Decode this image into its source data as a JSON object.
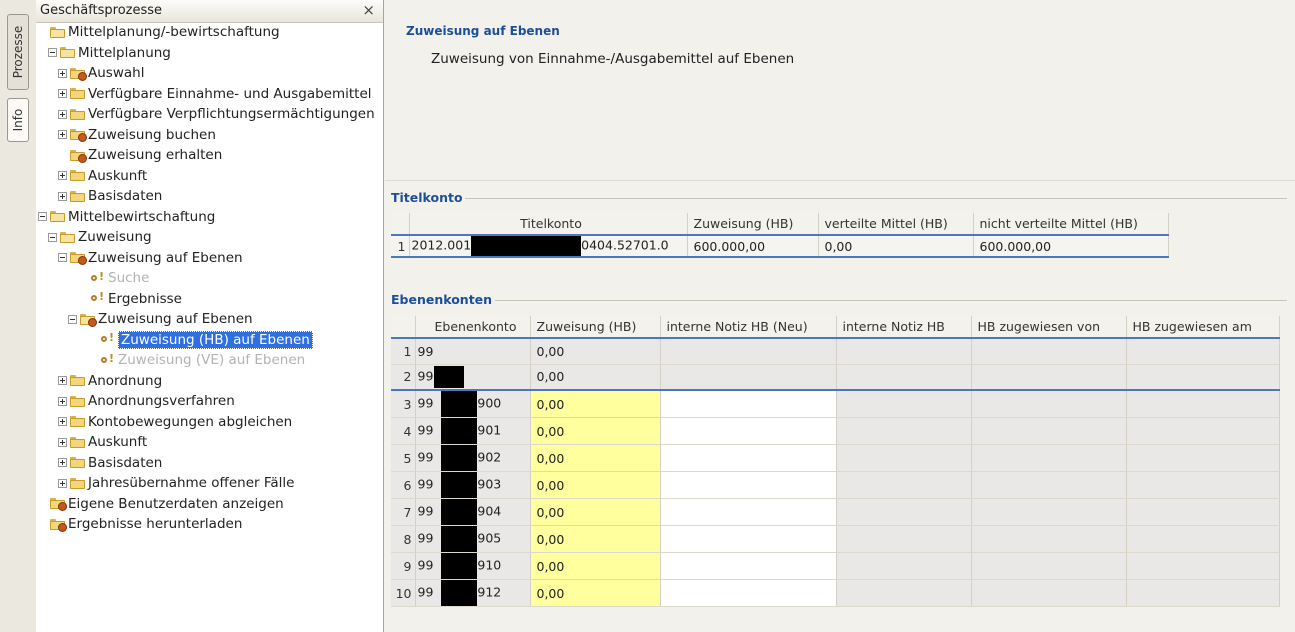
{
  "side_tabs": [
    "Prozesse",
    "Info"
  ],
  "tree_panel": {
    "title": "Geschäftsprozesse",
    "close": "×",
    "nodes": [
      {
        "label": "Mittelplanung/-bewirtschaftung",
        "icon": "folder-open-icon",
        "expander": "none"
      },
      {
        "label": "Mittelplanung",
        "icon": "folder-open-icon",
        "expander": "minus"
      },
      {
        "label": "Auswahl",
        "icon": "process-folder-icon",
        "expander": "plus"
      },
      {
        "label": "Verfügbare Einnahme- und Ausgabemittel",
        "icon": "folder-icon",
        "expander": "plus"
      },
      {
        "label": "Verfügbare Verpflichtungsermächtigungen",
        "icon": "folder-icon",
        "expander": "plus"
      },
      {
        "label": "Zuweisung buchen",
        "icon": "process-folder-icon",
        "expander": "plus"
      },
      {
        "label": "Zuweisung erhalten",
        "icon": "process-folder-icon",
        "expander": "none"
      },
      {
        "label": "Auskunft",
        "icon": "folder-icon",
        "expander": "plus"
      },
      {
        "label": "Basisdaten",
        "icon": "folder-icon",
        "expander": "plus"
      },
      {
        "label": "Mittelbewirtschaftung",
        "icon": "folder-open-icon",
        "expander": "minus"
      },
      {
        "label": "Zuweisung",
        "icon": "folder-open-icon",
        "expander": "minus"
      },
      {
        "label": "Zuweisung auf Ebenen",
        "icon": "process-folder-icon",
        "expander": "minus"
      },
      {
        "label": "Suche",
        "icon": "key-icon",
        "expander": "none",
        "state": "disabled"
      },
      {
        "label": "Ergebnisse",
        "icon": "key-icon",
        "expander": "none"
      },
      {
        "label": "Zuweisung auf Ebenen",
        "icon": "process-folder-open-icon",
        "expander": "minus"
      },
      {
        "label": "Zuweisung (HB) auf Ebenen",
        "icon": "key-icon",
        "expander": "none",
        "state": "selected"
      },
      {
        "label": "Zuweisung (VE) auf Ebenen",
        "icon": "key-icon",
        "expander": "none",
        "state": "disabled"
      },
      {
        "label": "Anordnung",
        "icon": "folder-icon",
        "expander": "plus"
      },
      {
        "label": "Anordnungsverfahren",
        "icon": "folder-icon",
        "expander": "plus"
      },
      {
        "label": "Kontobewegungen abgleichen",
        "icon": "folder-icon",
        "expander": "plus"
      },
      {
        "label": "Auskunft",
        "icon": "folder-icon",
        "expander": "plus"
      },
      {
        "label": "Basisdaten",
        "icon": "folder-icon",
        "expander": "plus"
      },
      {
        "label": "Jahresübernahme offener Fälle",
        "icon": "folder-icon",
        "expander": "plus"
      },
      {
        "label": "Eigene Benutzerdaten anzeigen",
        "icon": "process-folder-icon",
        "expander": "none"
      },
      {
        "label": "Ergebnisse herunterladen",
        "icon": "process-folder-icon",
        "expander": "none"
      }
    ]
  },
  "content": {
    "title": "Zuweisung auf Ebenen",
    "description": "Zuweisung von Einnahme-/Ausgabemittel auf Ebenen",
    "titelkonto": {
      "section_label": "Titelkonto",
      "columns": [
        "Titelkonto",
        "Zuweisung (HB)",
        "verteilte Mittel (HB)",
        "nicht verteilte Mittel (HB)"
      ],
      "rows": [
        {
          "num": "1",
          "konto_prefix": "2012.001",
          "konto_suffix": "0404.52701.0",
          "zuweisung": "600.000,00",
          "verteilt": "0,00",
          "nicht_verteilt": "600.000,00"
        }
      ]
    },
    "ebenenkonten": {
      "section_label": "Ebenenkonten",
      "columns": [
        "Ebenenkonto",
        "Zuweisung (HB)",
        "interne Notiz HB (Neu)",
        "interne Notiz HB",
        "HB zugewiesen von",
        "HB zugewiesen am"
      ],
      "rows": [
        {
          "num": "1",
          "prefix": "99",
          "suffix": "",
          "zuweisung": "0,00"
        },
        {
          "num": "2",
          "prefix": "99",
          "suffix": "",
          "zuweisung": "0,00"
        },
        {
          "num": "3",
          "prefix": "99",
          "suffix": "900",
          "zuweisung": "0,00"
        },
        {
          "num": "4",
          "prefix": "99",
          "suffix": "901",
          "zuweisung": "0,00"
        },
        {
          "num": "5",
          "prefix": "99",
          "suffix": "902",
          "zuweisung": "0,00"
        },
        {
          "num": "6",
          "prefix": "99",
          "suffix": "903",
          "zuweisung": "0,00"
        },
        {
          "num": "7",
          "prefix": "99",
          "suffix": "904",
          "zuweisung": "0,00"
        },
        {
          "num": "8",
          "prefix": "99",
          "suffix": "905",
          "zuweisung": "0,00"
        },
        {
          "num": "9",
          "prefix": "99",
          "suffix": "910",
          "zuweisung": "0,00"
        },
        {
          "num": "10",
          "prefix": "99",
          "suffix": "912",
          "zuweisung": "0,00"
        }
      ]
    }
  }
}
